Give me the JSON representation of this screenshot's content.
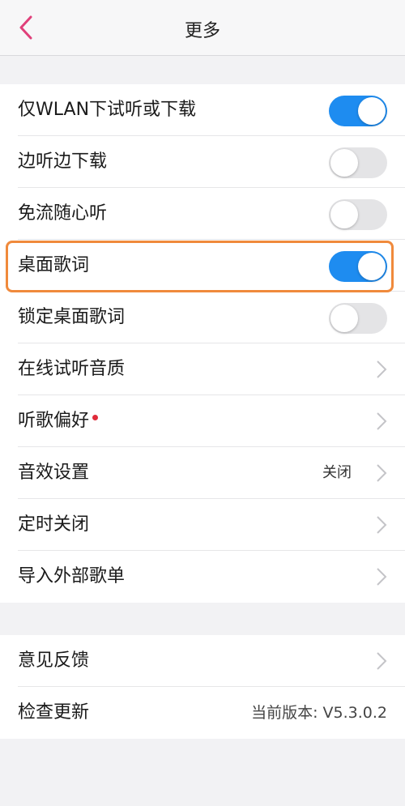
{
  "header": {
    "title": "更多",
    "back_icon": "chevron-left-icon",
    "accent": "#e0407a"
  },
  "settings": [
    {
      "label": "仅WLAN下试听或下载",
      "control": "toggle",
      "on": true
    },
    {
      "label": "边听边下载",
      "control": "toggle",
      "on": false
    },
    {
      "label": "免流随心听",
      "control": "toggle",
      "on": false
    },
    {
      "label": "桌面歌词",
      "control": "toggle",
      "on": true,
      "highlighted": true
    },
    {
      "label": "锁定桌面歌词",
      "control": "toggle",
      "on": false
    },
    {
      "label": "在线试听音质",
      "control": "chevron"
    },
    {
      "label": "听歌偏好",
      "control": "chevron",
      "badge": "red-dot"
    },
    {
      "label": "音效设置",
      "control": "chevron",
      "value": "关闭"
    },
    {
      "label": "定时关闭",
      "control": "chevron"
    },
    {
      "label": "导入外部歌单",
      "control": "chevron"
    }
  ],
  "settings2": [
    {
      "label": "意见反馈",
      "control": "chevron"
    },
    {
      "label": "检查更新",
      "control": "text",
      "value": "当前版本: V5.3.0.2"
    }
  ],
  "colors": {
    "toggle_on": "#1e8cf0",
    "toggle_off": "#e4e4e6",
    "highlight": "#f08a3c",
    "badge": "#e02b3a"
  }
}
